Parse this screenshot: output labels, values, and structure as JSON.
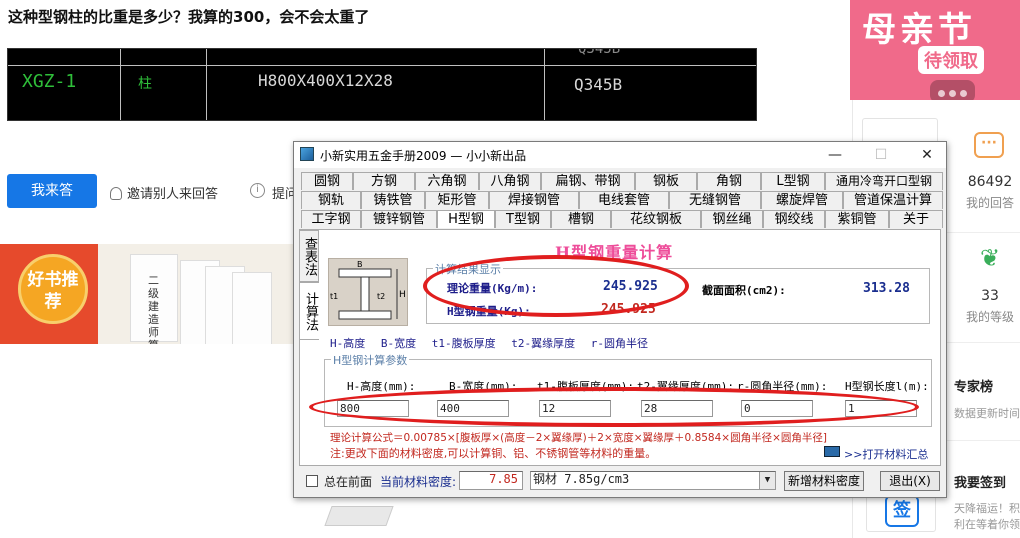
{
  "page": {
    "question_title": "这种型钢柱的比重是多少？我算的300，会不会太重了",
    "cad": {
      "top_partial": "Q345B",
      "code": "XGZ-1",
      "kind": "柱",
      "spec": "H800X400X12X28",
      "grade": "Q345B"
    },
    "answer_button": "我来答",
    "invite_label": "邀请别人来回答",
    "ask_label": "提问",
    "banner": {
      "badge": "好书推荐",
      "book_text": "二级建造师算量实用宝典"
    }
  },
  "right": {
    "ad": {
      "main": "母亲节",
      "sub": "待领取"
    },
    "answers": {
      "count": "86492",
      "label": "我的回答"
    },
    "level": {
      "count": "33",
      "label": "我的等级"
    },
    "expert": {
      "title": "专家榜",
      "sub": "数据更新时间"
    },
    "signin": {
      "title": "我要签到",
      "sub1": "天降福运！积",
      "sub2": "利在等着你领",
      "icon_text": "签"
    }
  },
  "app": {
    "title": "小新实用五金手册2009 — 小小新出品",
    "tab_rows": [
      [
        "圆钢",
        "方钢",
        "六角钢",
        "八角钢",
        "扁钢、带钢",
        "钢板",
        "角钢",
        "L型钢",
        "通用冷弯开口型钢"
      ],
      [
        "钢轨",
        "铸铁管",
        "矩形管",
        "焊接钢管",
        "电线套管",
        "无缝钢管",
        "螺旋焊管",
        "管道保温计算"
      ],
      [
        "工字钢",
        "镀锌钢管",
        "H型钢",
        "T型钢",
        "槽钢",
        "花纹钢板",
        "钢丝绳",
        "钢绞线",
        "紫铜管",
        "关于"
      ]
    ],
    "active_tab": "H型钢",
    "vtabs": [
      "查表法",
      "计算法"
    ],
    "heading": "H型钢重量计算",
    "result": {
      "group_label": "计算结果显示",
      "theory_label": "理论重量(Kg/m):",
      "theory_value": "245.925",
      "weight_label": "H型钢重量(Kg):",
      "weight_value": "245.925",
      "area_label": "截面面积(cm2):",
      "area_value": "313.28"
    },
    "legend": "H-高度  B-宽度  t1-腹板厚度  t2-翼缘厚度  r-圆角半径",
    "params": {
      "group_label": "H型钢计算参数",
      "labels": [
        "H-高度(mm):",
        "B-宽度(mm):",
        "t1-腹板厚度(mm):",
        "t2-翼缘厚度(mm):",
        "r-圆角半径(mm):",
        "H型钢长度l(m):"
      ],
      "values": [
        "800",
        "400",
        "12",
        "28",
        "0",
        "1"
      ]
    },
    "formula": "理论计算公式＝0.00785×[腹板厚×(高度－2×翼缘厚)＋2×宽度×翼缘厚＋0.8584×圆角半径×圆角半径]",
    "note": "注:更改下面的材料密度,可以计算铜、铝、不锈钢管等材料的重量。",
    "summary_link": ">>打开材料汇总",
    "bottom": {
      "always_on_top": "总在前面",
      "density_label": "当前材料密度:",
      "density_value": "7.85",
      "material_select": "钢材 7.85g/cm3",
      "add_button": "新增材料密度",
      "exit_button": "退出(X)"
    },
    "colors": {
      "accent_red": "#e01e1e",
      "heading": "#ee4d9a",
      "value_blue": "#1a2e8f"
    }
  }
}
